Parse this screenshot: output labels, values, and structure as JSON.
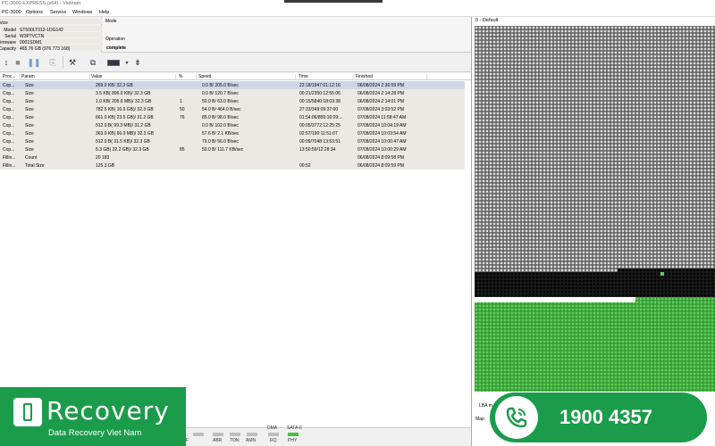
{
  "window": {
    "title": "PC-3000 EXPRESS (x64) - Vietnam"
  },
  "menu": [
    "PC-3000",
    "Options",
    "Service",
    "Windows",
    "Help"
  ],
  "device": {
    "header": "vice",
    "fields": [
      {
        "key": "Model",
        "value": "ST500LT012-1DG142"
      },
      {
        "key": "Serial",
        "value": "W3P7VCTN"
      },
      {
        "key": "Firmware",
        "value": "0001SDM1"
      },
      {
        "key": "Capacity",
        "value": "465.76 GB (976 773 168)"
      }
    ]
  },
  "mode": {
    "label": "Mode",
    "operation_label": "Operation",
    "operation_value": "complete"
  },
  "grid": {
    "columns": [
      "Proc...",
      "Param",
      "Value",
      "%",
      "Speed",
      "Time",
      "Finished"
    ],
    "rows": [
      {
        "proc": "Cop...",
        "param": "Size",
        "value": "269.0 KB/ 32.3 GB",
        "pct": "",
        "speed": "0.0 B/ 205.0 B/sec",
        "time": "22:18/1947:01:12:16",
        "finished": "06/08/2024 2:36:59 PM"
      },
      {
        "proc": "Cop...",
        "param": "Size",
        "value": "3.5 KB( 896.0 KB)/ 32.3 GB",
        "pct": "",
        "speed": "0.0 B/ 120.7 B/sec",
        "time": "00:21/2350:12:55:06",
        "finished": "06/08/2024 2:14:28 PM"
      },
      {
        "proc": "Cop...",
        "param": "Size",
        "value": "1.0 KB( 205.6 MB)/ 32.3 GB",
        "pct": "1",
        "speed": "50.0 B/ 63.0 B/sec",
        "time": "00:15/5840:18:03:38",
        "finished": "06/08/2024 2:14:01 PM"
      },
      {
        "proc": "Cop...",
        "param": "Size",
        "value": "782.5 KB( 16.6 GB)/ 32.3 GB",
        "pct": "50",
        "speed": "54.0 B/ 464.0 B/sec",
        "time": "27:33/349:09:37:00",
        "finished": "07/08/2024 3:03:52 PM"
      },
      {
        "proc": "Cop...",
        "param": "Size",
        "value": "661.0 KB( 23.5 GB)/ 31.2 GB",
        "pct": "76",
        "speed": "85.0 B/ 98.0 B/sec",
        "time": "01:54:06/859:16:09:...",
        "finished": "07/08/2024 11:58:47 AM"
      },
      {
        "proc": "Cop...",
        "param": "Size",
        "value": "512.0 B( 99.3 MB)/ 31.2 GB",
        "pct": "",
        "speed": "0.0 B/ 102.0 B/sec",
        "time": "00:05/3772:12:25:25",
        "finished": "07/08/2024 10:04:19 AM"
      },
      {
        "proc": "Cop...",
        "param": "Size",
        "value": "363.0 KB( 66.0 MB)/ 32.3 GB",
        "pct": "",
        "speed": "57.6 B/ 2.1 KB/sec",
        "time": "02:57/190:11:51:07",
        "finished": "07/08/2024 10:03:54 AM"
      },
      {
        "proc": "Cop...",
        "param": "Size",
        "value": "512.0 B( 31.5 KB)/ 32.3 GB",
        "pct": "",
        "speed": "79.0 B/ 56.0 B/sec",
        "time": "00:09/7048:13:53:51",
        "finished": "07/08/2024 10:00:47 AM"
      },
      {
        "proc": "Cop...",
        "param": "Size",
        "value": "5.3 GB( 22.2 GB)/ 32.3 GB",
        "pct": "85",
        "speed": "50.0 B/ 111.7 KB/sec",
        "time": "13:50:59/12:28:34",
        "finished": "07/08/2024 10:00:29 AM"
      },
      {
        "proc": "Fillin...",
        "param": "Count",
        "value": "20 183",
        "pct": "",
        "speed": "",
        "time": "",
        "finished": "06/08/2024 8:09:58 PM"
      },
      {
        "proc": "Fillin...",
        "param": "Total Size",
        "value": "125.3 GB",
        "pct": "",
        "speed": "",
        "time": "00:52",
        "finished": "06/08/2024 8:09:59 PM"
      }
    ]
  },
  "status": {
    "indicators": [
      {
        "label": "F",
        "on": false
      },
      {
        "label": "ABR",
        "on": false
      },
      {
        "label": "TON",
        "on": false
      },
      {
        "label": "AMN",
        "on": false
      }
    ],
    "dma": {
      "label": "DMA",
      "sub": "RQ",
      "on": false
    },
    "sata": {
      "label": "SATA-II",
      "sub": "PHY",
      "on": true
    }
  },
  "map": {
    "title": "0 - Default",
    "lba_label": "LBA m",
    "map_label": "Map"
  },
  "branding": {
    "brand": "Recovery",
    "tagline": "Data Recovery Viet Nam",
    "phone": "1900 4357",
    "green": "#1a9c4a"
  }
}
